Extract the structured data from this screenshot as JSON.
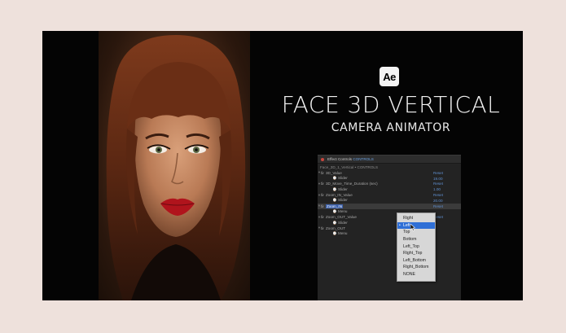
{
  "app_badge": "Ae",
  "title": "FACE 3D VERTICAL",
  "subtitle": "CAMERA ANIMATOR",
  "panel": {
    "tab_prefix": "Effect Controls",
    "tab_layer": "CONTROLS",
    "path": "Face_3D_1_Vertical • CONTROLS",
    "rows": [
      {
        "twirl": "▾",
        "fx": "fx",
        "label": "3D_Value",
        "value": "Reset",
        "type": "effect"
      },
      {
        "twirl": "",
        "fx": "",
        "label": "⌚ Slider",
        "value": "19.00",
        "type": "sub"
      },
      {
        "twirl": "▾",
        "fx": "fx",
        "label": "3D_Move_Time_Duration (sec)",
        "value": "Reset",
        "type": "effect"
      },
      {
        "twirl": "",
        "fx": "",
        "label": "⌚ Slider",
        "value": "1.00",
        "type": "sub"
      },
      {
        "twirl": "▾",
        "fx": "fx",
        "label": "Zoom_IN_Value",
        "value": "Reset",
        "type": "effect"
      },
      {
        "twirl": "",
        "fx": "",
        "label": "⌚ Slider",
        "value": "20.00",
        "type": "sub"
      },
      {
        "twirl": "▾",
        "fx": "fx",
        "label": "Zoom_IN",
        "value": "Reset",
        "type": "selected"
      },
      {
        "twirl": "",
        "fx": "",
        "label": "⌚ Menu",
        "value": "",
        "type": "sub"
      },
      {
        "twirl": "▾",
        "fx": "fx",
        "label": "Zoom_OUT_Value",
        "value": "Reset",
        "type": "effect"
      },
      {
        "twirl": "",
        "fx": "",
        "label": "⌚ Slider",
        "value": "",
        "type": "sub"
      },
      {
        "twirl": "▾",
        "fx": "fx",
        "label": "Zoom_OUT",
        "value": "",
        "type": "effect"
      },
      {
        "twirl": "",
        "fx": "",
        "label": "⌚ Menu",
        "value": "",
        "type": "sub"
      }
    ]
  },
  "dropdown": {
    "options": [
      "Right",
      "Left",
      "Top",
      "Bottom",
      "Left_Top",
      "Right_Top",
      "Left_Bottom",
      "Right_Bottom",
      "NONE"
    ],
    "selected": "Left",
    "check": "•"
  },
  "colors": {
    "background": "#eee1dc",
    "canvas": "#040404",
    "accent_blue": "#2f6fd6",
    "lips": "#b0141c"
  }
}
